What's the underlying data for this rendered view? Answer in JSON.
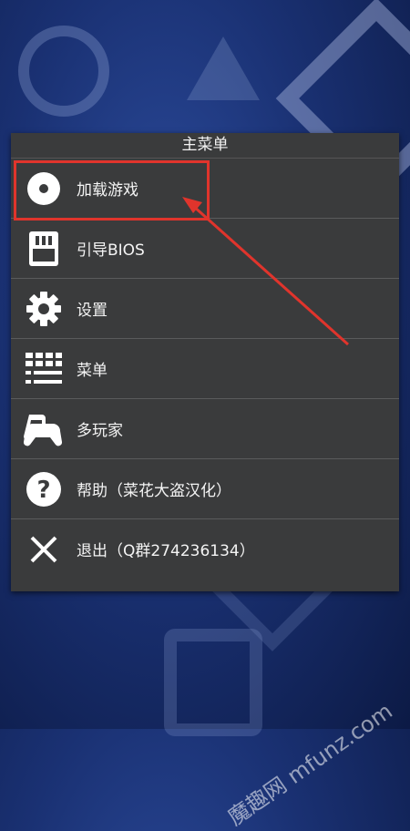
{
  "menu": {
    "title": "主菜单",
    "items": [
      {
        "label": "加载游戏",
        "icon": "disc-icon"
      },
      {
        "label": "引导BIOS",
        "icon": "memory-card-icon"
      },
      {
        "label": "设置",
        "icon": "gear-icon"
      },
      {
        "label": "菜单",
        "icon": "menu-grid-icon"
      },
      {
        "label": "多玩家",
        "icon": "gamepad-icon"
      },
      {
        "label": "帮助（菜花大盗汉化）",
        "icon": "help-icon"
      },
      {
        "label": "退出（Q群274236134）",
        "icon": "close-icon"
      }
    ]
  },
  "annotation": {
    "color": "#e0342c"
  },
  "watermark": {
    "text": "魔趣网 mfunz.com"
  }
}
